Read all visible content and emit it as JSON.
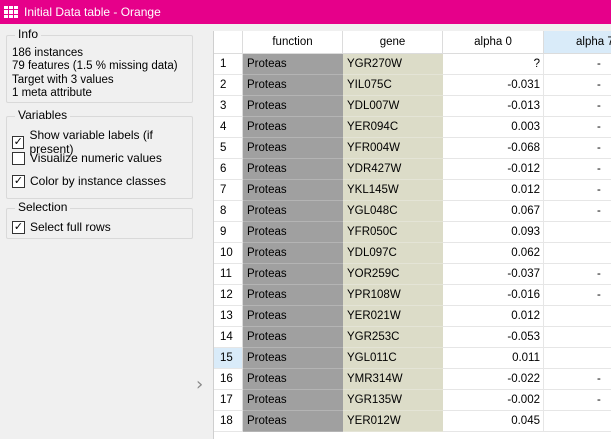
{
  "window": {
    "title": "Initial Data table - Orange",
    "icon": "table-icon",
    "title_bar_color": "#e6008a"
  },
  "info": {
    "title": "Info",
    "lines": [
      "186 instances",
      "79 features (1.5 % missing data)",
      "Target with 3 values",
      "1 meta attribute"
    ]
  },
  "variables": {
    "title": "Variables",
    "options": [
      {
        "label": "Show variable labels (if present)",
        "checked": true
      },
      {
        "label": "Visualize numeric values",
        "checked": false
      },
      {
        "label": "Color by instance classes",
        "checked": true
      }
    ]
  },
  "selection": {
    "title": "Selection",
    "options": [
      {
        "label": "Select full rows",
        "checked": true
      }
    ]
  },
  "table": {
    "columns": [
      "function",
      "gene",
      "alpha 0",
      "alpha 7"
    ],
    "selected_header": "alpha 7",
    "colors": {
      "function_bg": "#a0a0a0",
      "gene_bg": "#dcdcc8",
      "selection": "#d9ebf9"
    },
    "rows": [
      {
        "n": "1",
        "function": "Proteas",
        "gene": "YGR270W",
        "alpha0": "?",
        "alpha7": "-"
      },
      {
        "n": "2",
        "function": "Proteas",
        "gene": "YIL075C",
        "alpha0": "-0.031",
        "alpha7": "-"
      },
      {
        "n": "3",
        "function": "Proteas",
        "gene": "YDL007W",
        "alpha0": "-0.013",
        "alpha7": "-"
      },
      {
        "n": "4",
        "function": "Proteas",
        "gene": "YER094C",
        "alpha0": "0.003",
        "alpha7": "-"
      },
      {
        "n": "5",
        "function": "Proteas",
        "gene": "YFR004W",
        "alpha0": "-0.068",
        "alpha7": "-"
      },
      {
        "n": "6",
        "function": "Proteas",
        "gene": "YDR427W",
        "alpha0": "-0.012",
        "alpha7": "-"
      },
      {
        "n": "7",
        "function": "Proteas",
        "gene": "YKL145W",
        "alpha0": "0.012",
        "alpha7": "-"
      },
      {
        "n": "8",
        "function": "Proteas",
        "gene": "YGL048C",
        "alpha0": "0.067",
        "alpha7": "-"
      },
      {
        "n": "9",
        "function": "Proteas",
        "gene": "YFR050C",
        "alpha0": "0.093",
        "alpha7": ""
      },
      {
        "n": "10",
        "function": "Proteas",
        "gene": "YDL097C",
        "alpha0": "0.062",
        "alpha7": ""
      },
      {
        "n": "11",
        "function": "Proteas",
        "gene": "YOR259C",
        "alpha0": "-0.037",
        "alpha7": "-"
      },
      {
        "n": "12",
        "function": "Proteas",
        "gene": "YPR108W",
        "alpha0": "-0.016",
        "alpha7": "-"
      },
      {
        "n": "13",
        "function": "Proteas",
        "gene": "YER021W",
        "alpha0": "0.012",
        "alpha7": ""
      },
      {
        "n": "14",
        "function": "Proteas",
        "gene": "YGR253C",
        "alpha0": "-0.053",
        "alpha7": ""
      },
      {
        "n": "15",
        "function": "Proteas",
        "gene": "YGL011C",
        "alpha0": "0.011",
        "alpha7": "",
        "selected": true
      },
      {
        "n": "16",
        "function": "Proteas",
        "gene": "YMR314W",
        "alpha0": "-0.022",
        "alpha7": "-"
      },
      {
        "n": "17",
        "function": "Proteas",
        "gene": "YGR135W",
        "alpha0": "-0.002",
        "alpha7": "-"
      },
      {
        "n": "18",
        "function": "Proteas",
        "gene": "YER012W",
        "alpha0": "0.045",
        "alpha7": ""
      }
    ]
  }
}
